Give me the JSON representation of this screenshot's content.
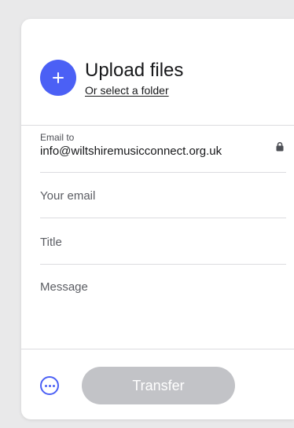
{
  "upload": {
    "add_icon": "plus-icon",
    "title": "Upload files",
    "folder_link": "Or select a folder"
  },
  "recipient": {
    "label": "Email to",
    "value": "info@wiltshiremusicconnect.org.uk",
    "lock_icon": "lock-icon"
  },
  "form": {
    "your_email_placeholder": "Your email",
    "title_placeholder": "Title",
    "message_placeholder": "Message"
  },
  "footer": {
    "more_icon": "more-options-icon",
    "transfer_label": "Transfer"
  },
  "colors": {
    "accent": "#4b60f5",
    "disabled_button": "#c2c3c7",
    "background": "#e9e9ea"
  }
}
